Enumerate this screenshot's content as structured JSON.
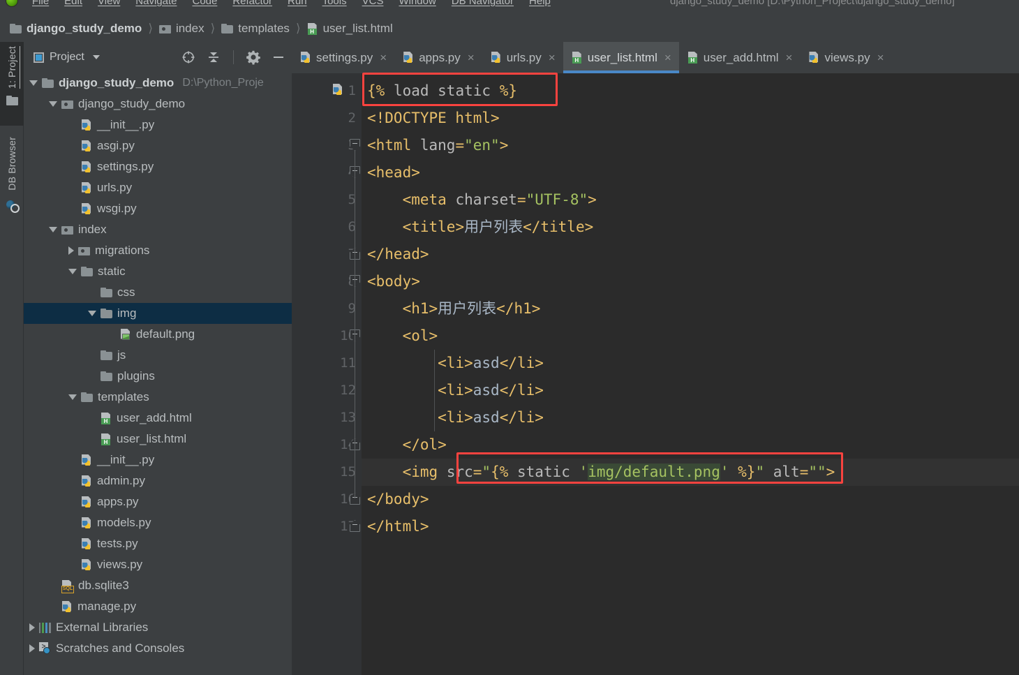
{
  "window": {
    "title": "django_study_demo [D:\\Python_Project\\django_study_demo]",
    "menu": [
      "File",
      "Edit",
      "View",
      "Navigate",
      "Code",
      "Refactor",
      "Run",
      "Tools",
      "VCS",
      "Window",
      "DB Navigator",
      "Help"
    ]
  },
  "breadcrumb": [
    {
      "label": "django_study_demo",
      "icon": "folder-icon"
    },
    {
      "label": "index",
      "icon": "module-folder-icon"
    },
    {
      "label": "templates",
      "icon": "folder-icon"
    },
    {
      "label": "user_list.html",
      "icon": "html-file-icon"
    }
  ],
  "left_strip": {
    "project_tab": "1: Project",
    "db_browser_tab": "DB Browser"
  },
  "project_panel": {
    "title": "Project",
    "tools": [
      "locate-icon",
      "collapse-all-icon",
      "settings-icon",
      "hide-icon"
    ],
    "tree": [
      {
        "label": "django_study_demo",
        "path": "D:\\Python_Proje",
        "icon": "folder-icon",
        "arrow": "down",
        "indent": 0,
        "bold": true,
        "selected": false
      },
      {
        "label": "django_study_demo",
        "path": "",
        "icon": "module-folder-icon",
        "arrow": "down",
        "indent": 1,
        "bold": false,
        "selected": false
      },
      {
        "label": "__init__.py",
        "path": "",
        "icon": "python-file-icon",
        "arrow": "none",
        "indent": 2,
        "bold": false,
        "selected": false
      },
      {
        "label": "asgi.py",
        "path": "",
        "icon": "python-file-icon",
        "arrow": "none",
        "indent": 2,
        "bold": false,
        "selected": false
      },
      {
        "label": "settings.py",
        "path": "",
        "icon": "python-file-icon",
        "arrow": "none",
        "indent": 2,
        "bold": false,
        "selected": false
      },
      {
        "label": "urls.py",
        "path": "",
        "icon": "python-file-icon",
        "arrow": "none",
        "indent": 2,
        "bold": false,
        "selected": false
      },
      {
        "label": "wsgi.py",
        "path": "",
        "icon": "python-file-icon",
        "arrow": "none",
        "indent": 2,
        "bold": false,
        "selected": false
      },
      {
        "label": "index",
        "path": "",
        "icon": "module-folder-icon",
        "arrow": "down",
        "indent": 1,
        "bold": false,
        "selected": false
      },
      {
        "label": "migrations",
        "path": "",
        "icon": "module-folder-icon",
        "arrow": "right",
        "indent": 2,
        "bold": false,
        "selected": false
      },
      {
        "label": "static",
        "path": "",
        "icon": "folder-icon",
        "arrow": "down",
        "indent": 2,
        "bold": false,
        "selected": false
      },
      {
        "label": "css",
        "path": "",
        "icon": "folder-icon",
        "arrow": "none",
        "indent": 3,
        "bold": false,
        "selected": false
      },
      {
        "label": "img",
        "path": "",
        "icon": "folder-icon",
        "arrow": "down",
        "indent": 3,
        "bold": false,
        "selected": true
      },
      {
        "label": "default.png",
        "path": "",
        "icon": "image-file-icon",
        "arrow": "none",
        "indent": 4,
        "bold": false,
        "selected": false
      },
      {
        "label": "js",
        "path": "",
        "icon": "folder-icon",
        "arrow": "none",
        "indent": 3,
        "bold": false,
        "selected": false
      },
      {
        "label": "plugins",
        "path": "",
        "icon": "folder-icon",
        "arrow": "none",
        "indent": 3,
        "bold": false,
        "selected": false
      },
      {
        "label": "templates",
        "path": "",
        "icon": "folder-icon",
        "arrow": "down",
        "indent": 2,
        "bold": false,
        "selected": false
      },
      {
        "label": "user_add.html",
        "path": "",
        "icon": "html-file-icon",
        "arrow": "none",
        "indent": 3,
        "bold": false,
        "selected": false
      },
      {
        "label": "user_list.html",
        "path": "",
        "icon": "html-file-icon",
        "arrow": "none",
        "indent": 3,
        "bold": false,
        "selected": false
      },
      {
        "label": "__init__.py",
        "path": "",
        "icon": "python-file-icon",
        "arrow": "none",
        "indent": 2,
        "bold": false,
        "selected": false
      },
      {
        "label": "admin.py",
        "path": "",
        "icon": "python-file-icon",
        "arrow": "none",
        "indent": 2,
        "bold": false,
        "selected": false
      },
      {
        "label": "apps.py",
        "path": "",
        "icon": "python-file-icon",
        "arrow": "none",
        "indent": 2,
        "bold": false,
        "selected": false
      },
      {
        "label": "models.py",
        "path": "",
        "icon": "python-file-icon",
        "arrow": "none",
        "indent": 2,
        "bold": false,
        "selected": false
      },
      {
        "label": "tests.py",
        "path": "",
        "icon": "python-file-icon",
        "arrow": "none",
        "indent": 2,
        "bold": false,
        "selected": false
      },
      {
        "label": "views.py",
        "path": "",
        "icon": "python-file-icon",
        "arrow": "none",
        "indent": 2,
        "bold": false,
        "selected": false
      },
      {
        "label": "db.sqlite3",
        "path": "",
        "icon": "sqlite-file-icon",
        "arrow": "none",
        "indent": 1,
        "bold": false,
        "selected": false
      },
      {
        "label": "manage.py",
        "path": "",
        "icon": "python-file-icon",
        "arrow": "none",
        "indent": 1,
        "bold": false,
        "selected": false
      },
      {
        "label": "External Libraries",
        "path": "",
        "icon": "libraries-icon",
        "arrow": "right",
        "indent": 0,
        "bold": false,
        "selected": false
      },
      {
        "label": "Scratches and Consoles",
        "path": "",
        "icon": "scratches-icon",
        "arrow": "right",
        "indent": 0,
        "bold": false,
        "selected": false
      }
    ]
  },
  "editor": {
    "tabs": [
      {
        "label": "settings.py",
        "icon": "python-file-icon",
        "active": false
      },
      {
        "label": "apps.py",
        "icon": "python-file-icon",
        "active": false
      },
      {
        "label": "urls.py",
        "icon": "python-file-icon",
        "active": false
      },
      {
        "label": "user_list.html",
        "icon": "html-file-icon",
        "active": true
      },
      {
        "label": "user_add.html",
        "icon": "html-file-icon",
        "active": false
      },
      {
        "label": "views.py",
        "icon": "python-file-icon",
        "active": false
      }
    ],
    "close_glyph": "×",
    "current_line": 15,
    "accent_tab_underline": "#4a88c7",
    "annotation_color": "#f8433f",
    "lines": [
      {
        "n": 1,
        "text": "{% load static %}"
      },
      {
        "n": 2,
        "text": "<!DOCTYPE html>"
      },
      {
        "n": 3,
        "text": "<html lang=\"en\">"
      },
      {
        "n": 4,
        "text": "<head>"
      },
      {
        "n": 5,
        "text": "    <meta charset=\"UTF-8\">"
      },
      {
        "n": 6,
        "text": "    <title>用户列表</title>"
      },
      {
        "n": 7,
        "text": "</head>"
      },
      {
        "n": 8,
        "text": "<body>"
      },
      {
        "n": 9,
        "text": "    <h1>用户列表</h1>"
      },
      {
        "n": 10,
        "text": "    <ol>"
      },
      {
        "n": 11,
        "text": "        <li>asd</li>"
      },
      {
        "n": 12,
        "text": "        <li>asd</li>"
      },
      {
        "n": 13,
        "text": "        <li>asd</li>"
      },
      {
        "n": 14,
        "text": "    </ol>"
      },
      {
        "n": 15,
        "text": "    <img src=\"{% static 'img/default.png' %}\" alt=\"\">"
      },
      {
        "n": 16,
        "text": "</body>"
      },
      {
        "n": 17,
        "text": "</html>"
      }
    ]
  }
}
